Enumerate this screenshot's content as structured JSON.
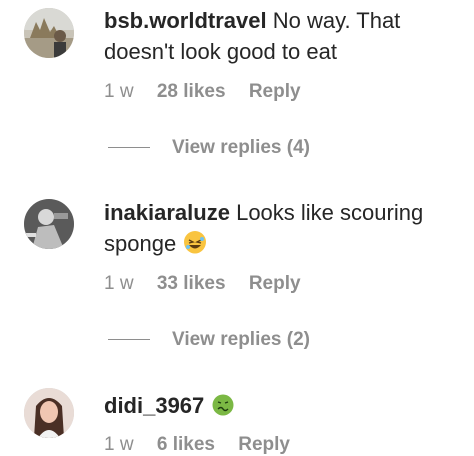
{
  "comments": [
    {
      "username": "bsb.worldtravel",
      "text_line1": "No way. That",
      "text_line2": "doesn't look good to eat",
      "time": "1 w",
      "likes": "28 likes",
      "reply": "Reply",
      "view_replies": "View replies (4)"
    },
    {
      "username": "inakiaraluze",
      "text_line1": "Looks like scouring",
      "text_line2": "sponge",
      "emoji": "rolling-on-floor-laughing-emoji",
      "time": "1 w",
      "likes": "33 likes",
      "reply": "Reply",
      "view_replies": "View replies (2)"
    },
    {
      "username": "didi_3967",
      "text_line1": "",
      "emoji": "nauseated-face-emoji",
      "time": "1 w",
      "likes": "6 likes",
      "reply": "Reply"
    }
  ],
  "colors": {
    "text": "#262626",
    "meta": "#8e8e8e",
    "laugh_emoji": "#f9c440",
    "sick_emoji": "#7bb844"
  }
}
